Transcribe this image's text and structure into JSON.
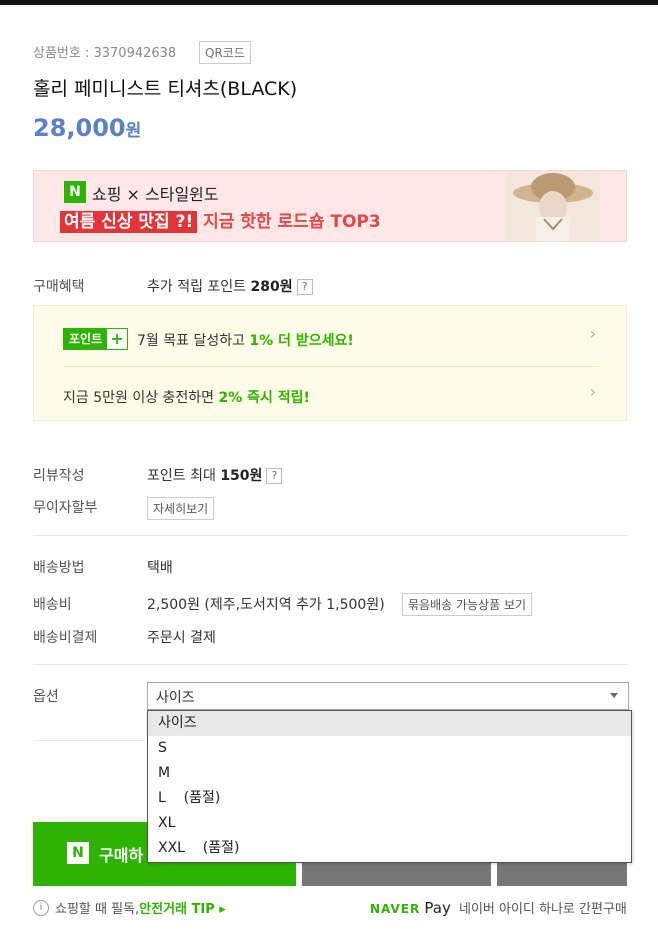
{
  "product": {
    "code_label": "상품번호 : 3370942638",
    "qr_label": "QR코드",
    "title": "홀리 페미니스트 티셔츠(BLACK)",
    "price": "28,000",
    "price_unit": "원"
  },
  "banner": {
    "n_logo": "N",
    "line1": "쇼핑 × 스타일윈도",
    "highlight": "여름 신상 맛집 ?!",
    "rest": "지금 핫한 로드숍 TOP3"
  },
  "benefit": {
    "label": "구매혜택",
    "prefix": "추가 적립 포인트 ",
    "points": "280원",
    "help": "?"
  },
  "point_box": {
    "badge": "포인트",
    "badge_plus": "+",
    "row1_prefix": "7월 목표 달성하고 ",
    "row1_highlight": "1% 더 받으세요!",
    "row2_prefix": "지금 5만원 이상 충전하면 ",
    "row2_highlight": "2% 즉시 적립!",
    "chevron": "›"
  },
  "review": {
    "label": "리뷰작성",
    "prefix": "포인트 최대 ",
    "points": "150원",
    "help": "?"
  },
  "installment": {
    "label": "무이자할부",
    "button": "자세히보기"
  },
  "shipping": {
    "method_label": "배송방법",
    "method_value": "택배",
    "fee_label": "배송비",
    "fee_value": "2,500원 (제주,도서지역 추가 1,500원)",
    "bundle_button": "묶음배송 가능상품 보기",
    "payment_label": "배송비결제",
    "payment_value": "주문시 결제"
  },
  "option": {
    "label": "옵션",
    "selected": "사이즈",
    "options": [
      "사이즈",
      "S",
      "M",
      "L    (품절)",
      "XL",
      "XXL    (품절)"
    ]
  },
  "actions": {
    "buy_n": "N",
    "buy_label": "구매하"
  },
  "footer": {
    "info_icon": "i",
    "info_prefix": "쇼핑할 때 필독, ",
    "info_link": "안전거래 TIP ▸",
    "naver": "NAVER",
    "pay": "Pay",
    "pay_desc": "네이버 아이디 하나로 간편구매"
  },
  "colors": {
    "accent_green": "#2db400",
    "price_blue": "#5b82c4",
    "banner_red": "#e24a4a"
  }
}
